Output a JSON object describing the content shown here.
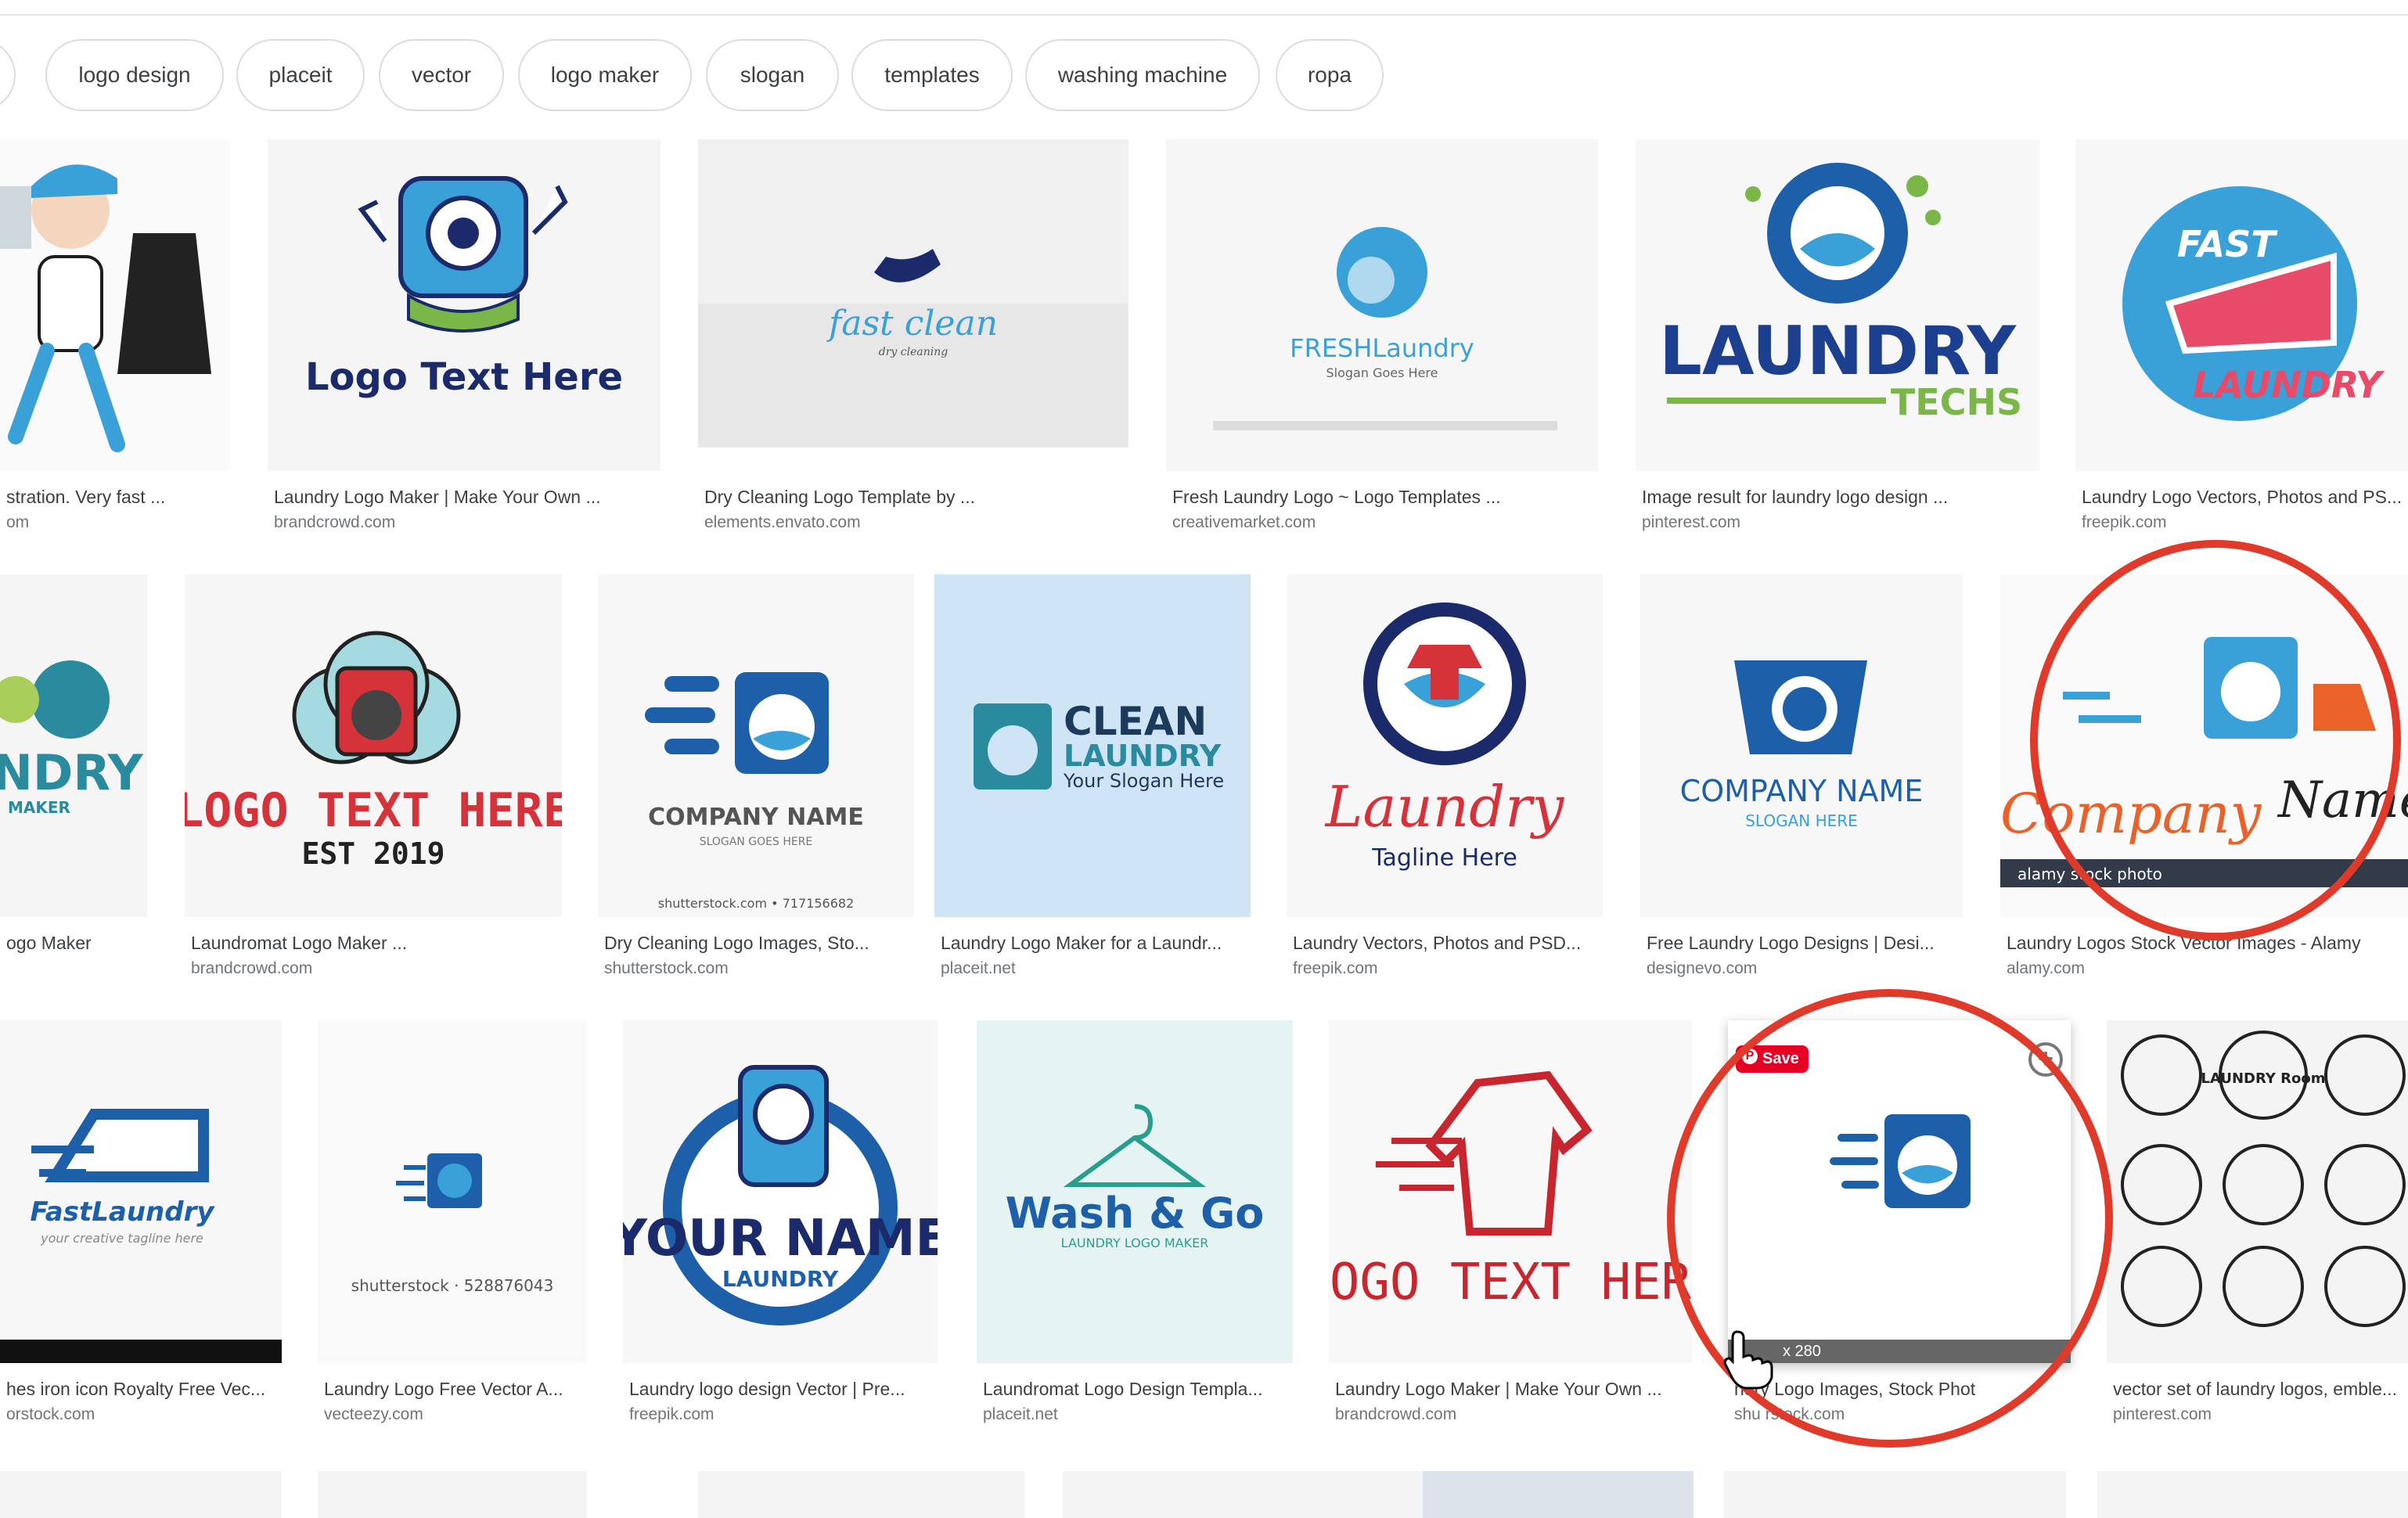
{
  "chips": [
    "logo design",
    "placeit",
    "vector",
    "logo maker",
    "slogan",
    "templates",
    "washing machine",
    "ropa"
  ],
  "rows": [
    [
      {
        "caption": "stration. Very fast ...",
        "source": "om",
        "art": "Laundry man mascot"
      },
      {
        "caption": "Laundry Logo Maker | Make Your Own ...",
        "source": "brandcrowd.com",
        "art": "Logo Text Here"
      },
      {
        "caption": "Dry Cleaning Logo Template by ...",
        "source": "elements.envato.com",
        "art": "fast clean"
      },
      {
        "caption": "Fresh Laundry Logo ~ Logo Templates ...",
        "source": "creativemarket.com",
        "art": "FRESHLaundry"
      },
      {
        "caption": "Image result for laundry logo design ...",
        "source": "pinterest.com",
        "art": "LAUNDRY"
      },
      {
        "caption": "Laundry Logo Vectors, Photos and PS...",
        "source": "freepik.com",
        "art": "FAST LAUNDRY"
      }
    ],
    [
      {
        "caption": "ogo Maker",
        "source": "",
        "art": "NDRY"
      },
      {
        "caption": "Laundromat Logo Maker ...",
        "source": "brandcrowd.com",
        "art": "LOGO TEXT HERE"
      },
      {
        "caption": "Dry Cleaning Logo Images, Sto...",
        "source": "shutterstock.com",
        "art": "COMPANY NAME"
      },
      {
        "caption": "Laundry Logo Maker for a Laundr...",
        "source": "placeit.net",
        "art": "CLEAN LAUNDRY"
      },
      {
        "caption": "Laundry Vectors, Photos and PSD...",
        "source": "freepik.com",
        "art": "Laundry"
      },
      {
        "caption": "Free Laundry Logo Designs | Desi...",
        "source": "designevo.com",
        "art": "COMPANY NAME"
      },
      {
        "caption": "Laundry Logos Stock Vector Images - Alamy",
        "source": "alamy.com",
        "art": "Company Name"
      }
    ],
    [
      {
        "caption": "hes iron icon Royalty Free Vec...",
        "source": "orstock.com",
        "art": "FastLaundry"
      },
      {
        "caption": "Laundry Logo Free Vector A...",
        "source": "vecteezy.com",
        "art": "shutterstock"
      },
      {
        "caption": "Laundry logo design Vector | Pre...",
        "source": "freepik.com",
        "art": "YOUR NAME"
      },
      {
        "caption": "Laundromat Logo Design Templa...",
        "source": "placeit.net",
        "art": "Wash & Go"
      },
      {
        "caption": "Laundry Logo Maker | Make Your Own ...",
        "source": "brandcrowd.com",
        "art": "LOGO TEXT HERE"
      },
      {
        "caption": "ndry Logo Images, Stock Phot",
        "source": "shu  rstock.com",
        "art": "washer"
      },
      {
        "caption": "vector set of laundry logos, emble...",
        "source": "pinterest.com",
        "art": "LAUNDRY set"
      }
    ]
  ],
  "art_text": {
    "logo_text_here": "Logo Text Here",
    "fast_clean": "fast clean",
    "dry_cleaning": "dry cleaning",
    "fresh": "FRESHLaundry",
    "slogan_goes_here": "Slogan Goes Here",
    "laundry": "LAUNDRY",
    "techs": "TECHS",
    "fast": "FAST",
    "laundry_script": "LAUNDRY",
    "ndry": "NDRY",
    "maker": "MAKER",
    "logo_text_caps": "LOGO TEXT HERE",
    "est": "EST 2019",
    "company_name": "COMPANY NAME",
    "slogan_caps": "SLOGAN GOES HERE",
    "ss_id1": "shutterstock.com • 717156682",
    "clean": "CLEAN",
    "clean_laundry": "LAUNDRY",
    "your_slogan": "Your Slogan Here",
    "laundry_cursive": "Laundry",
    "tagline": "Tagline  Here",
    "company_name2": "COMPANY NAME",
    "slogan_here": "SLOGAN HERE",
    "company_cursive": "Company",
    "name_cursive": "Name",
    "alamy": "alamy stock photo",
    "fastlaundry": "FastLaundry",
    "tagline2": "your creative tagline here",
    "ss_id2": "shutterstock · 528876043",
    "your_name": "YOUR NAME",
    "laundry_ribbon": "LAUNDRY",
    "wash_go": "Wash & Go",
    "laundry_logo_maker": "LAUNDRY LOGO MAKER",
    "logo_text_here3": "LOGO TEXT HERE",
    "save": "Save",
    "dims": "x 280",
    "laundry_room": "LAUNDRY Room"
  },
  "colors": {
    "accent_red": "#e03a2a",
    "pinterest_red": "#e60023",
    "blue": "#1d5fa8",
    "light_blue": "#3aa0d8",
    "green": "#7ab648"
  }
}
